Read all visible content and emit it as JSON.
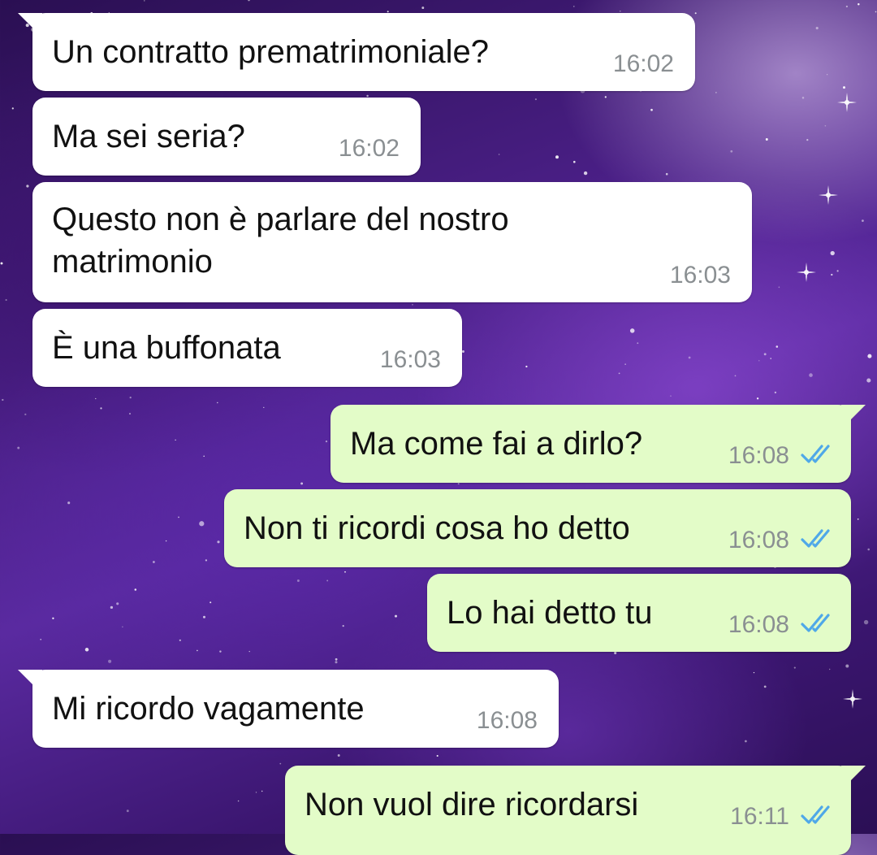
{
  "messages": [
    {
      "text": "Un contratto prematrimoniale?",
      "time": "16:02",
      "direction": "incoming"
    },
    {
      "text": "Ma sei seria?",
      "time": "16:02",
      "direction": "incoming"
    },
    {
      "text_lines": [
        "Questo non è parlare del nostro",
        "matrimonio"
      ],
      "time": "16:03",
      "direction": "incoming"
    },
    {
      "text": "È una buffonata",
      "time": "16:03",
      "direction": "incoming"
    },
    {
      "text": "Ma come fai a dirlo?",
      "time": "16:08",
      "direction": "outgoing",
      "status": "read"
    },
    {
      "text": "Non ti ricordi cosa ho detto",
      "time": "16:08",
      "direction": "outgoing",
      "status": "read"
    },
    {
      "text": "Lo hai detto tu",
      "time": "16:08",
      "direction": "outgoing",
      "status": "read"
    },
    {
      "text": "Mi ricordo vagamente",
      "time": "16:08",
      "direction": "incoming"
    },
    {
      "text": "Non vuol dire ricordarsi",
      "time": "16:11",
      "direction": "outgoing",
      "status": "read"
    }
  ],
  "colors": {
    "incoming_bubble": "#ffffff",
    "outgoing_bubble": "#e3fcc8",
    "read_ticks": "#4fa8e8",
    "timestamp": "#8a8f92"
  },
  "icons": {
    "read_receipt": "double-check-icon"
  }
}
